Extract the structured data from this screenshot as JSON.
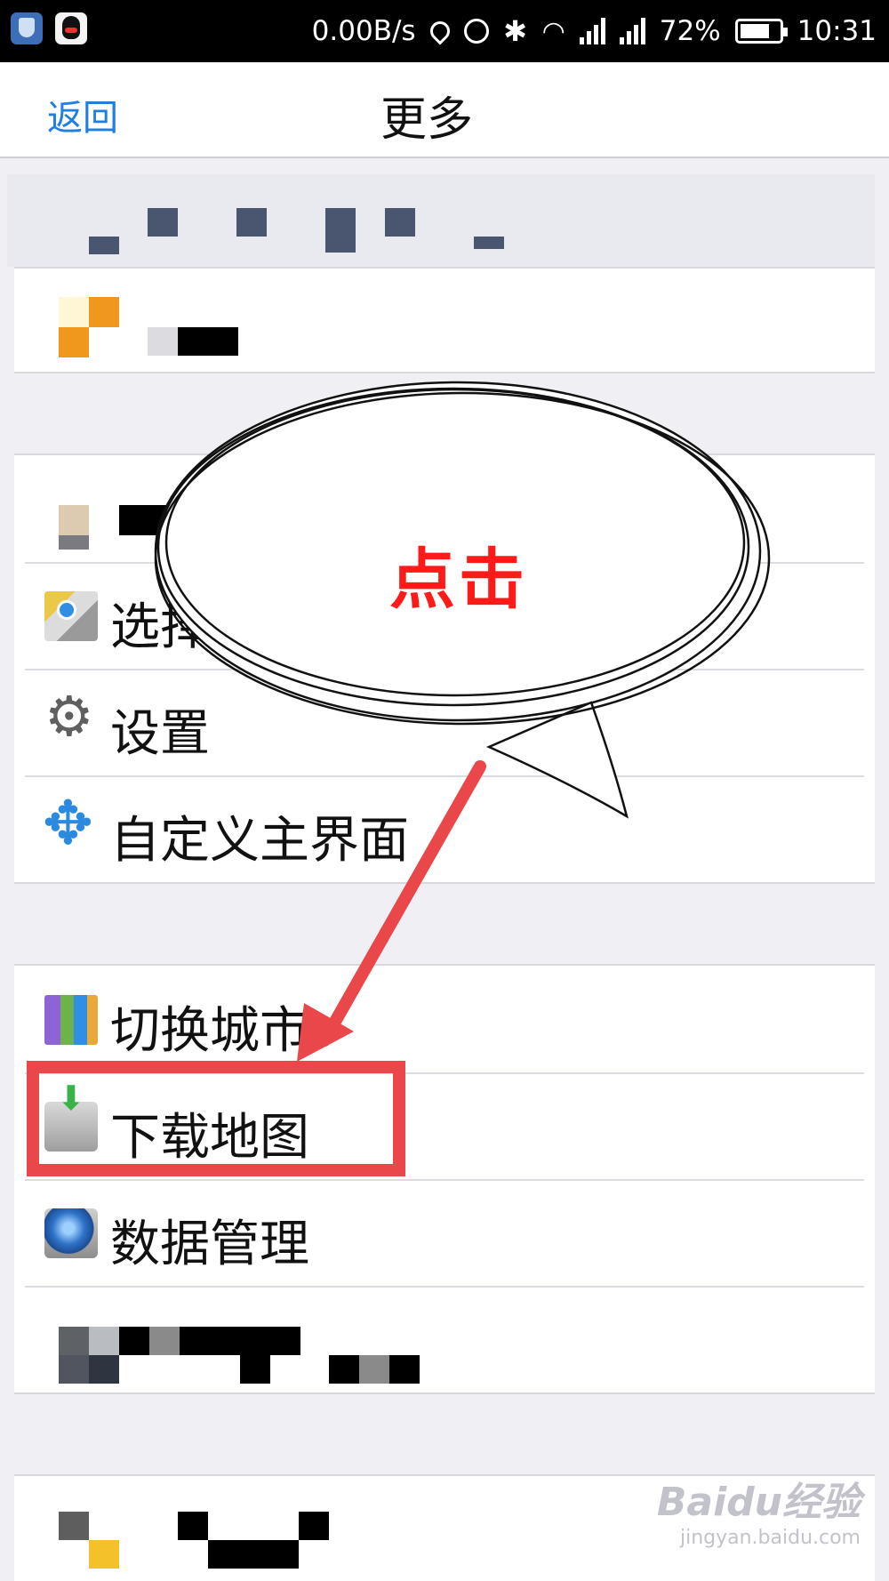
{
  "status_bar": {
    "speed": "0.00B/s",
    "battery_percent": "72%",
    "time": "10:31"
  },
  "navbar": {
    "back_label": "返回",
    "title": "更多"
  },
  "menu": {
    "group_main": {
      "items": [
        {
          "label": "选择",
          "icon": "map-icon",
          "partially_obscured": true
        },
        {
          "label": "设置",
          "icon": "gear-icon"
        },
        {
          "label": "自定义主界面",
          "icon": "move-arrows-icon"
        }
      ]
    },
    "group_city": {
      "items": [
        {
          "label": "切换城市",
          "icon": "city-buildings-icon"
        },
        {
          "label": "下载地图",
          "icon": "download-drive-icon",
          "highlighted": true
        },
        {
          "label": "数据管理",
          "icon": "globe-drive-icon"
        }
      ]
    }
  },
  "annotation": {
    "callout_text": "点击",
    "highlight_color": "#e9474a",
    "text_color": "#ff1a1a"
  },
  "watermark": {
    "logo": "Baidu经验",
    "url": "jingyan.baidu.com"
  },
  "colors": {
    "accent": "#1f7ee0",
    "background": "#efeff4"
  }
}
